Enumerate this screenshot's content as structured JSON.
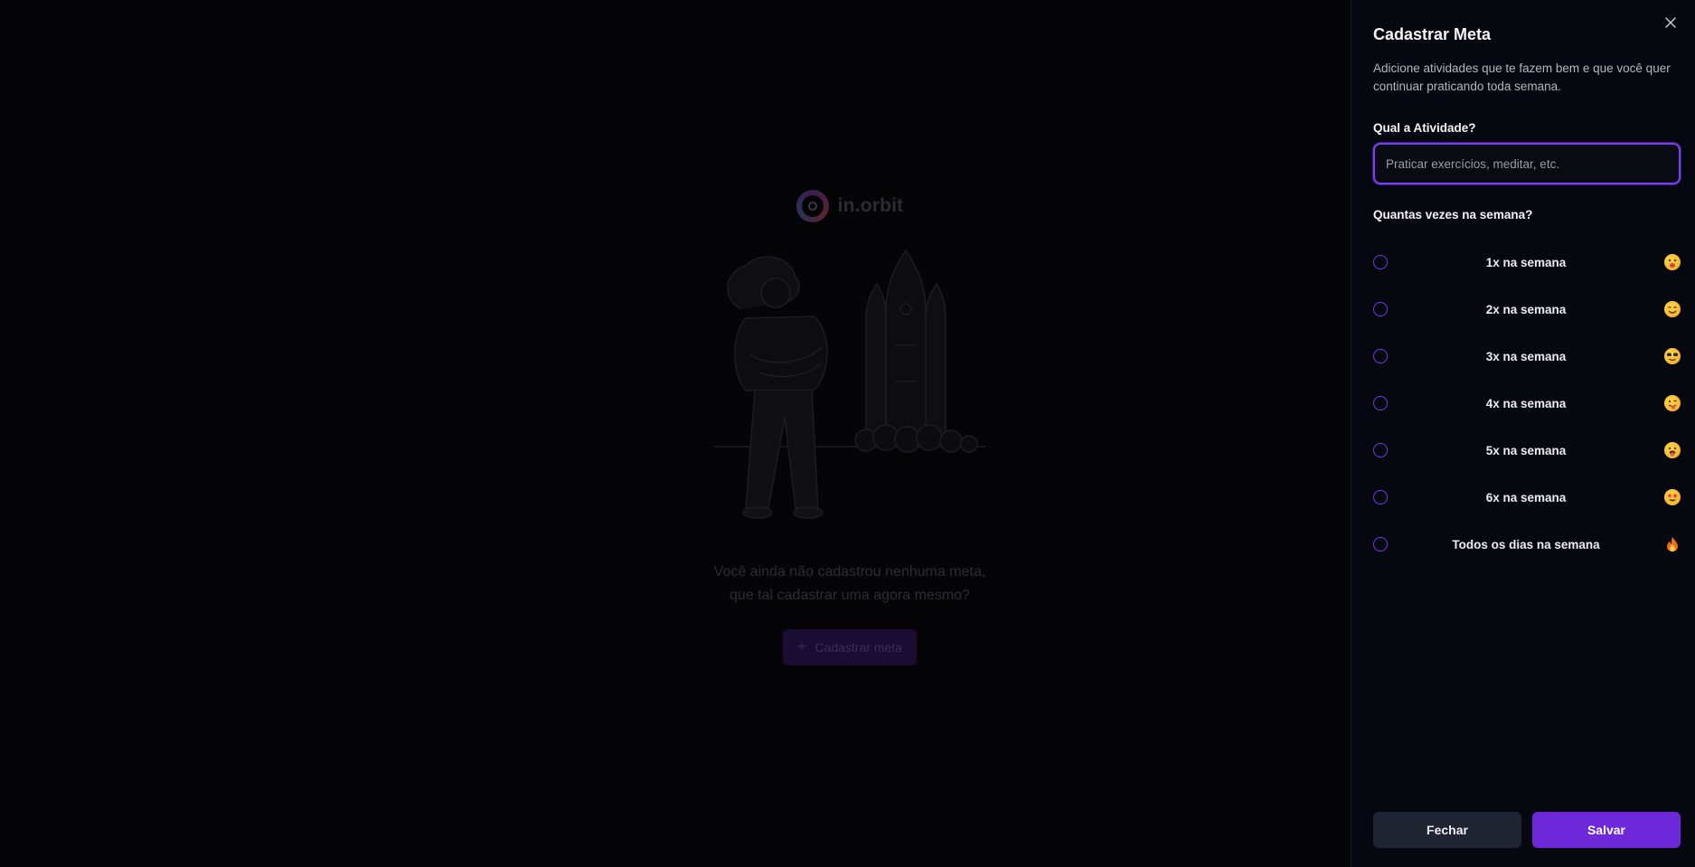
{
  "app": {
    "brand_name": "in.orbit",
    "empty_message_line1": "Você ainda não cadastrou nenhuma meta,",
    "empty_message_line2": "que tal cadastrar uma agora mesmo?",
    "cta_label": "Cadastrar meta",
    "cta_icon": "plus-icon"
  },
  "drawer": {
    "title": "Cadastrar Meta",
    "description": "Adicione atividades que te fazem bem e que você quer continuar praticando toda semana.",
    "close_icon": "close-icon",
    "activity_label": "Qual a Atividade?",
    "activity_placeholder": "Praticar exercícios, meditar, etc.",
    "activity_value": "",
    "frequency_label": "Quantas vezes na semana?",
    "options": [
      {
        "label": "1x na semana",
        "emoji": "face-yawning-emoji"
      },
      {
        "label": "2x na semana",
        "emoji": "face-smiling-emoji"
      },
      {
        "label": "3x na semana",
        "emoji": "face-sunglasses-emoji"
      },
      {
        "label": "4x na semana",
        "emoji": "face-tongue-emoji"
      },
      {
        "label": "5x na semana",
        "emoji": "face-tongue-out-emoji"
      },
      {
        "label": "6x na semana",
        "emoji": "face-star-eyes-emoji"
      },
      {
        "label": "Todos os dias na semana",
        "emoji": "fire-emoji"
      }
    ],
    "close_button": "Fechar",
    "save_button": "Salvar"
  },
  "colors": {
    "accent": "#6d28d9",
    "focus_ring": "#7a3ff0",
    "drawer_bg": "#06080f",
    "secondary_button": "#1e2431"
  }
}
